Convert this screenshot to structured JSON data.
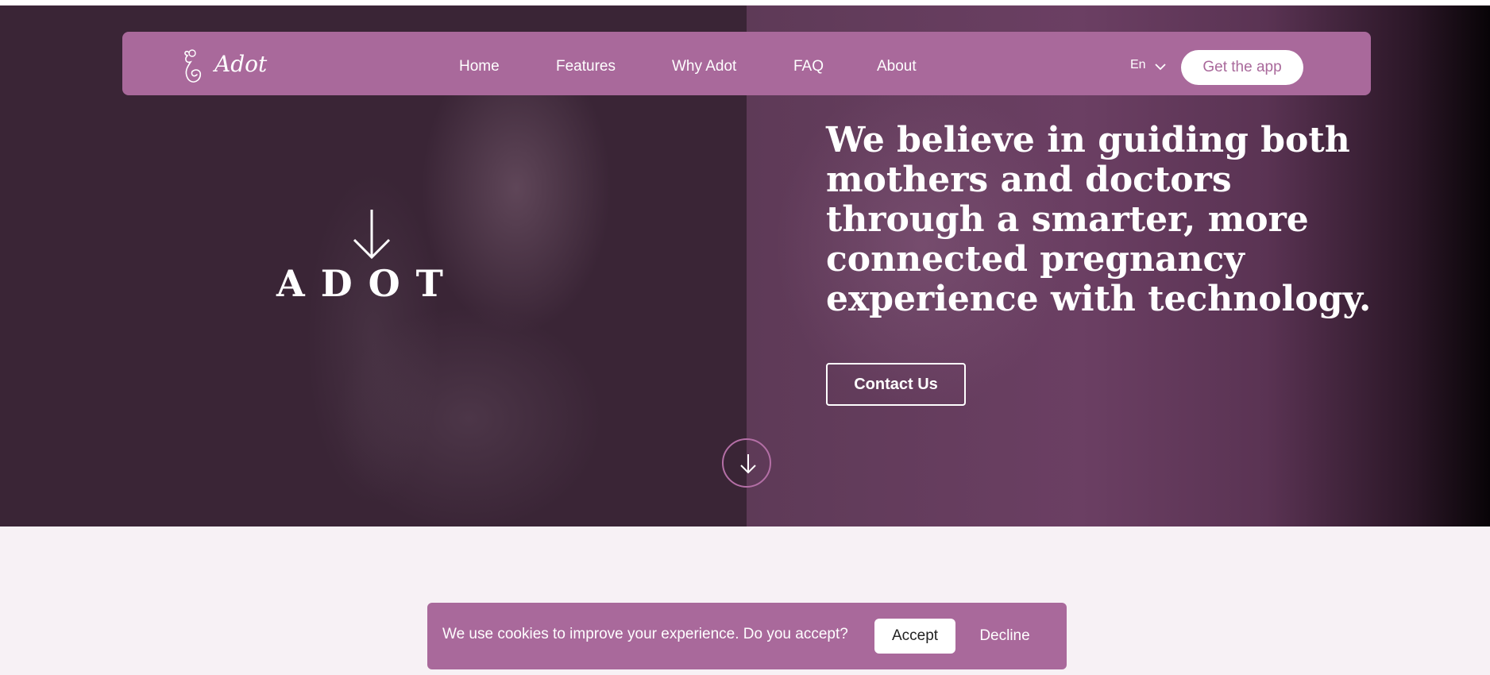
{
  "header": {
    "logo_text": "Adot",
    "nav": [
      {
        "label": "Home"
      },
      {
        "label": "Features"
      },
      {
        "label": "Why Adot"
      },
      {
        "label": "FAQ"
      },
      {
        "label": "About"
      }
    ],
    "language": "En",
    "get_app_label": "Get the app"
  },
  "hero": {
    "brand_name": "ADOT",
    "headline": "We believe in guiding both mothers and doctors through a smarter, more connected pregnancy experience with technology.",
    "contact_label": "Contact Us"
  },
  "cookie_banner": {
    "message": "We use cookies to improve your experience. Do you accept?",
    "accept_label": "Accept",
    "decline_label": "Decline"
  },
  "icons": {
    "logo": "mother-baby-logo-icon",
    "language_chevron": "chevron-down-icon",
    "brand_arrow": "arrow-down-icon",
    "scroll": "arrow-down-icon"
  },
  "colors": {
    "brand_purple": "#a9699b",
    "hero_dark": "#3a2536",
    "hero_plum": "#6b3f63",
    "page_background": "#f7f1f5",
    "scroll_ring": "#b46fa6"
  }
}
